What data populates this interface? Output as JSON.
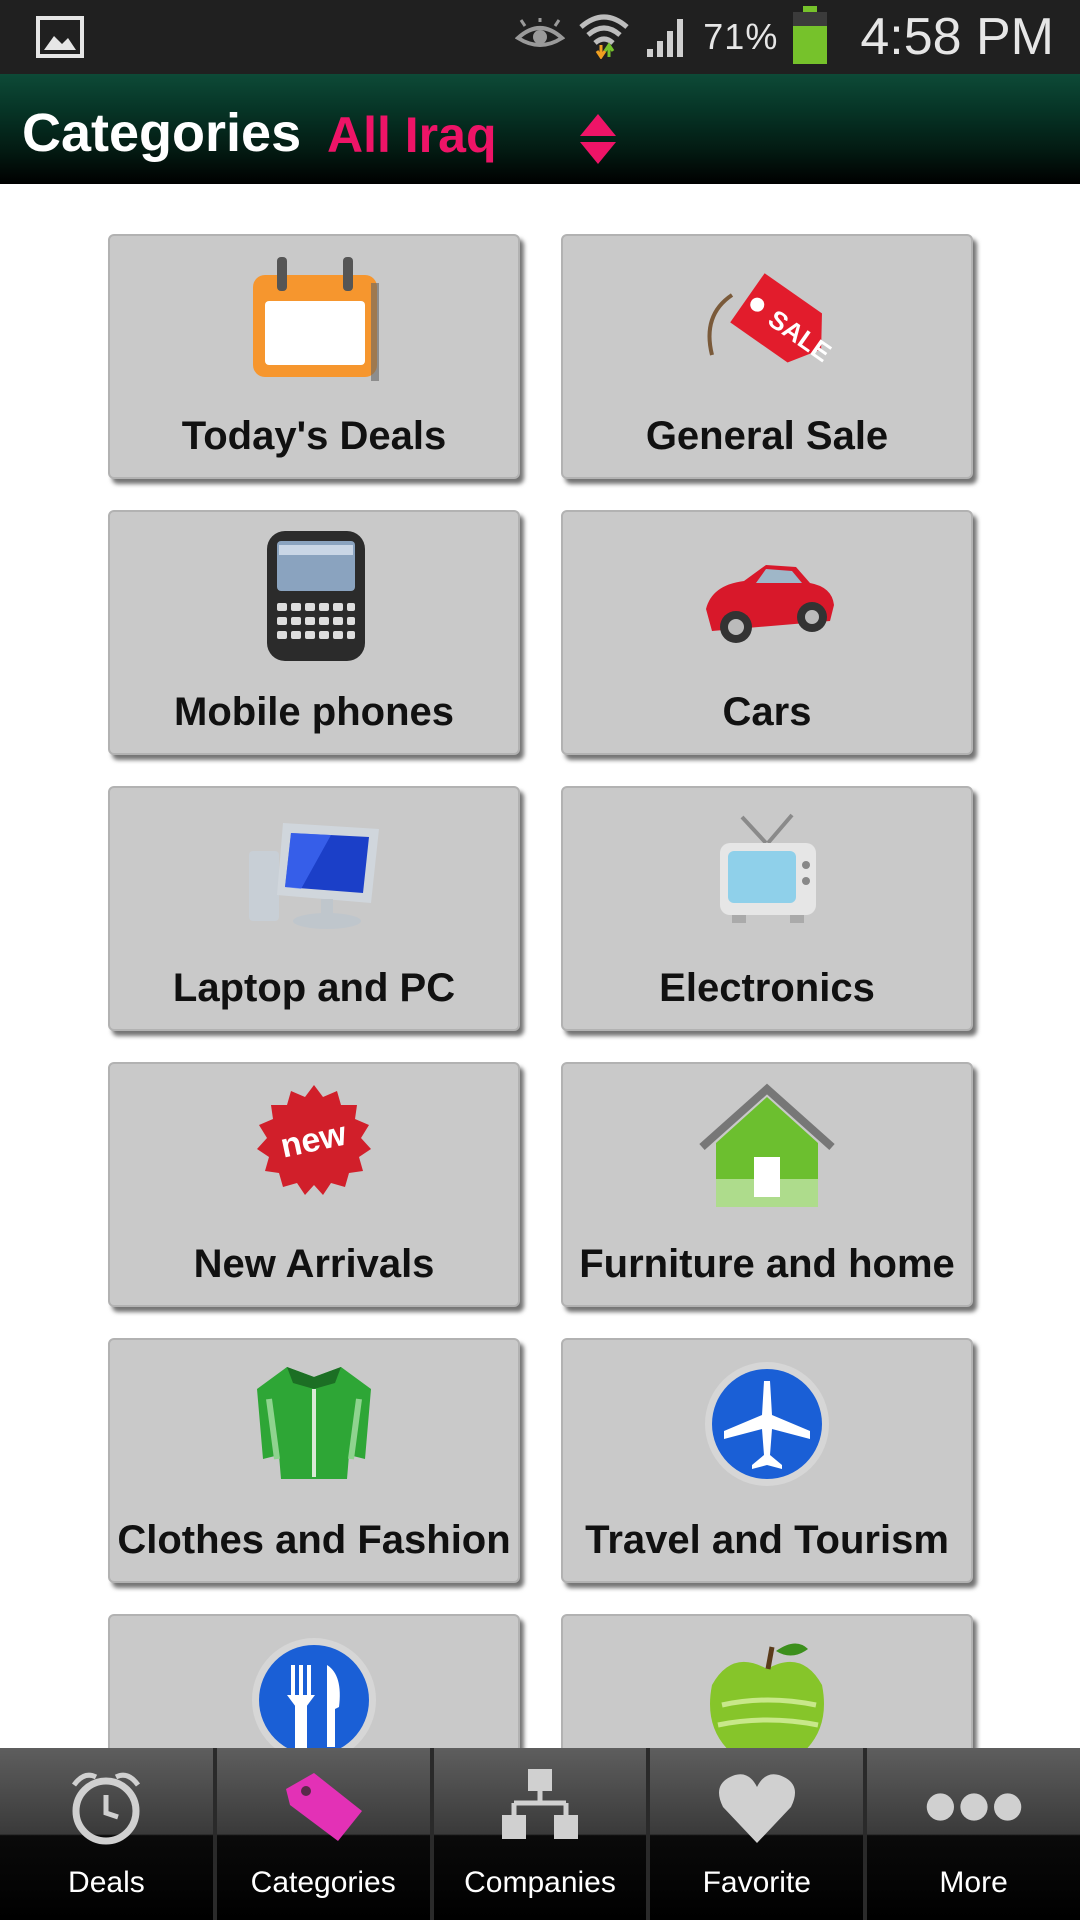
{
  "status_bar": {
    "battery_percent": "71%",
    "time": "4:58 PM"
  },
  "header": {
    "title": "Categories",
    "region": "All Iraq",
    "accent_color": "#ee1467"
  },
  "categories": [
    {
      "label": "Today's Deals",
      "icon": "calendar-icon"
    },
    {
      "label": "General Sale",
      "icon": "sale-tag-icon"
    },
    {
      "label": "Mobile phones",
      "icon": "mobile-phone-icon"
    },
    {
      "label": "Cars",
      "icon": "car-icon"
    },
    {
      "label": "Laptop and PC",
      "icon": "computer-icon"
    },
    {
      "label": "Electronics",
      "icon": "tv-icon"
    },
    {
      "label": "New Arrivals",
      "icon": "new-badge-icon"
    },
    {
      "label": "Furniture and home",
      "icon": "house-icon"
    },
    {
      "label": "Clothes and Fashion",
      "icon": "shirt-icon"
    },
    {
      "label": "Travel and Tourism",
      "icon": "airplane-icon"
    },
    {
      "label": "",
      "icon": "fork-knife-icon"
    },
    {
      "label": "",
      "icon": "apple-icon"
    }
  ],
  "bottom_nav": [
    {
      "label": "Deals",
      "icon": "alarm-clock-icon"
    },
    {
      "label": "Categories",
      "icon": "tag-icon",
      "active": true
    },
    {
      "label": "Companies",
      "icon": "org-chart-icon"
    },
    {
      "label": "Favorite",
      "icon": "heart-icon"
    },
    {
      "label": "More",
      "icon": "more-dots-icon"
    }
  ]
}
